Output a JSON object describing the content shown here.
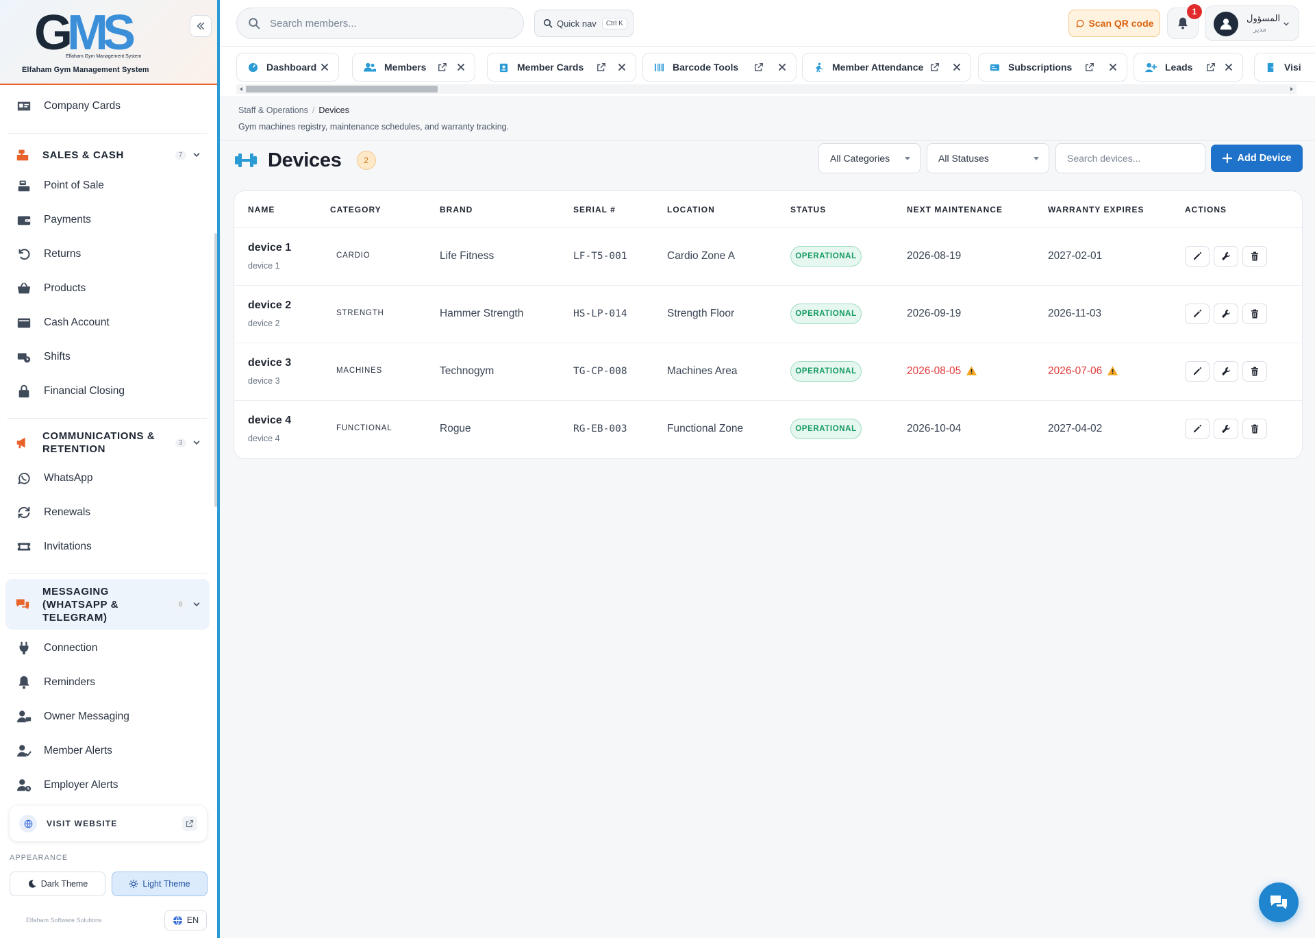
{
  "app": {
    "logo_letters": "GMS",
    "logo_small": "Elfaham Gym Management System",
    "logo_caption": "Elfaham Gym Management System"
  },
  "sidebar": {
    "items_top": [
      {
        "label": "Company Cards",
        "icon": "id-card-icon"
      }
    ],
    "sections": [
      {
        "title": "SALES & CASH",
        "count": "7",
        "icon": "cash-register-icon",
        "items": [
          {
            "label": "Point of Sale",
            "icon": "cash-register-icon"
          },
          {
            "label": "Payments",
            "icon": "wallet-icon"
          },
          {
            "label": "Returns",
            "icon": "undo-icon"
          },
          {
            "label": "Products",
            "icon": "basket-icon"
          },
          {
            "label": "Cash Account",
            "icon": "cash-icon"
          },
          {
            "label": "Shifts",
            "icon": "shift-icon"
          },
          {
            "label": "Financial Closing",
            "icon": "lock-icon"
          }
        ]
      },
      {
        "title_line1": "COMMUNICATIONS &",
        "title_line2": "RETENTION",
        "count": "3",
        "icon": "megaphone-icon",
        "items": [
          {
            "label": "WhatsApp",
            "icon": "whatsapp-icon"
          },
          {
            "label": "Renewals",
            "icon": "sync-icon"
          },
          {
            "label": "Invitations",
            "icon": "ticket-icon"
          }
        ]
      },
      {
        "title_line1": "MESSAGING",
        "title_line2": "(WHATSAPP &",
        "title_line3": "TELEGRAM)",
        "count": "6",
        "icon": "comments-icon",
        "items": [
          {
            "label": "Connection",
            "icon": "plug-icon"
          },
          {
            "label": "Reminders",
            "icon": "bell-icon"
          },
          {
            "label": "Owner Messaging",
            "icon": "user-comment-icon"
          },
          {
            "label": "Member Alerts",
            "icon": "user-check-icon"
          },
          {
            "label": "Employer Alerts",
            "icon": "user-clock-icon"
          }
        ]
      }
    ],
    "visit_website": "VISIT WEBSITE",
    "appearance_label": "APPEARANCE",
    "dark_theme": "Dark Theme",
    "light_theme": "Light Theme",
    "footer_brand": "Elfaham Software Solutions",
    "language": "EN"
  },
  "topbar": {
    "search_placeholder": "Search members...",
    "quick_nav": "Quick nav",
    "quick_nav_kbd": "Ctrl K",
    "scan_qr": "Scan QR code",
    "notifications_count": "1",
    "user_name": "المسؤول",
    "user_role": "مدير"
  },
  "tabs": [
    {
      "label": "Dashboard",
      "icon": "dashboard-icon"
    },
    {
      "label": "Members",
      "icon": "users-icon"
    },
    {
      "label": "Member Cards",
      "icon": "id-badge-icon"
    },
    {
      "label": "Barcode Tools",
      "icon": "barcode-icon"
    },
    {
      "label": "Member Attendance",
      "icon": "walking-icon"
    },
    {
      "label": "Subscriptions",
      "icon": "card-icon"
    },
    {
      "label": "Leads",
      "icon": "user-plus-icon"
    },
    {
      "label": "Visi",
      "icon": "door-icon"
    }
  ],
  "page": {
    "breadcrumb_parent": "Staff & Operations",
    "breadcrumb_sep": "/",
    "breadcrumb_current": "Devices",
    "subtitle": "Gym machines registry, maintenance schedules, and warranty tracking.",
    "title": "Devices",
    "count": "2",
    "filter_category": "All Categories",
    "filter_status": "All Statuses",
    "search_placeholder": "Search devices...",
    "add_button": "Add Device"
  },
  "table": {
    "columns": [
      "NAME",
      "CATEGORY",
      "BRAND",
      "SERIAL #",
      "LOCATION",
      "STATUS",
      "NEXT MAINTENANCE",
      "WARRANTY EXPIRES",
      "ACTIONS"
    ],
    "rows": [
      {
        "name": "device 1",
        "sub": "device 1",
        "category": "CARDIO",
        "brand": "Life Fitness",
        "serial": "LF-T5-001",
        "location": "Cardio Zone A",
        "status": "OPERATIONAL",
        "next_maintenance": "2026-08-19",
        "maintenance_overdue": false,
        "warranty": "2027-02-01",
        "warranty_warn": false
      },
      {
        "name": "device 2",
        "sub": "device 2",
        "category": "STRENGTH",
        "brand": "Hammer Strength",
        "serial": "HS-LP-014",
        "location": "Strength Floor",
        "status": "OPERATIONAL",
        "next_maintenance": "2026-09-19",
        "maintenance_overdue": false,
        "warranty": "2026-11-03",
        "warranty_warn": false
      },
      {
        "name": "device 3",
        "sub": "device 3",
        "category": "MACHINES",
        "brand": "Technogym",
        "serial": "TG-CP-008",
        "location": "Machines Area",
        "status": "OPERATIONAL",
        "next_maintenance": "2026-08-05",
        "maintenance_overdue": true,
        "warranty": "2026-07-06",
        "warranty_warn": true
      },
      {
        "name": "device 4",
        "sub": "device 4",
        "category": "FUNCTIONAL",
        "brand": "Rogue",
        "serial": "RG-EB-003",
        "location": "Functional Zone",
        "status": "OPERATIONAL",
        "next_maintenance": "2026-10-04",
        "maintenance_overdue": false,
        "warranty": "2027-04-02",
        "warranty_warn": false
      }
    ]
  },
  "colors": {
    "accent_blue": "#1f72c9",
    "brand_orange": "#e8622a",
    "status_green": "#159a62",
    "warning_red": "#e23b3b",
    "warning_amber": "#f5a623"
  }
}
